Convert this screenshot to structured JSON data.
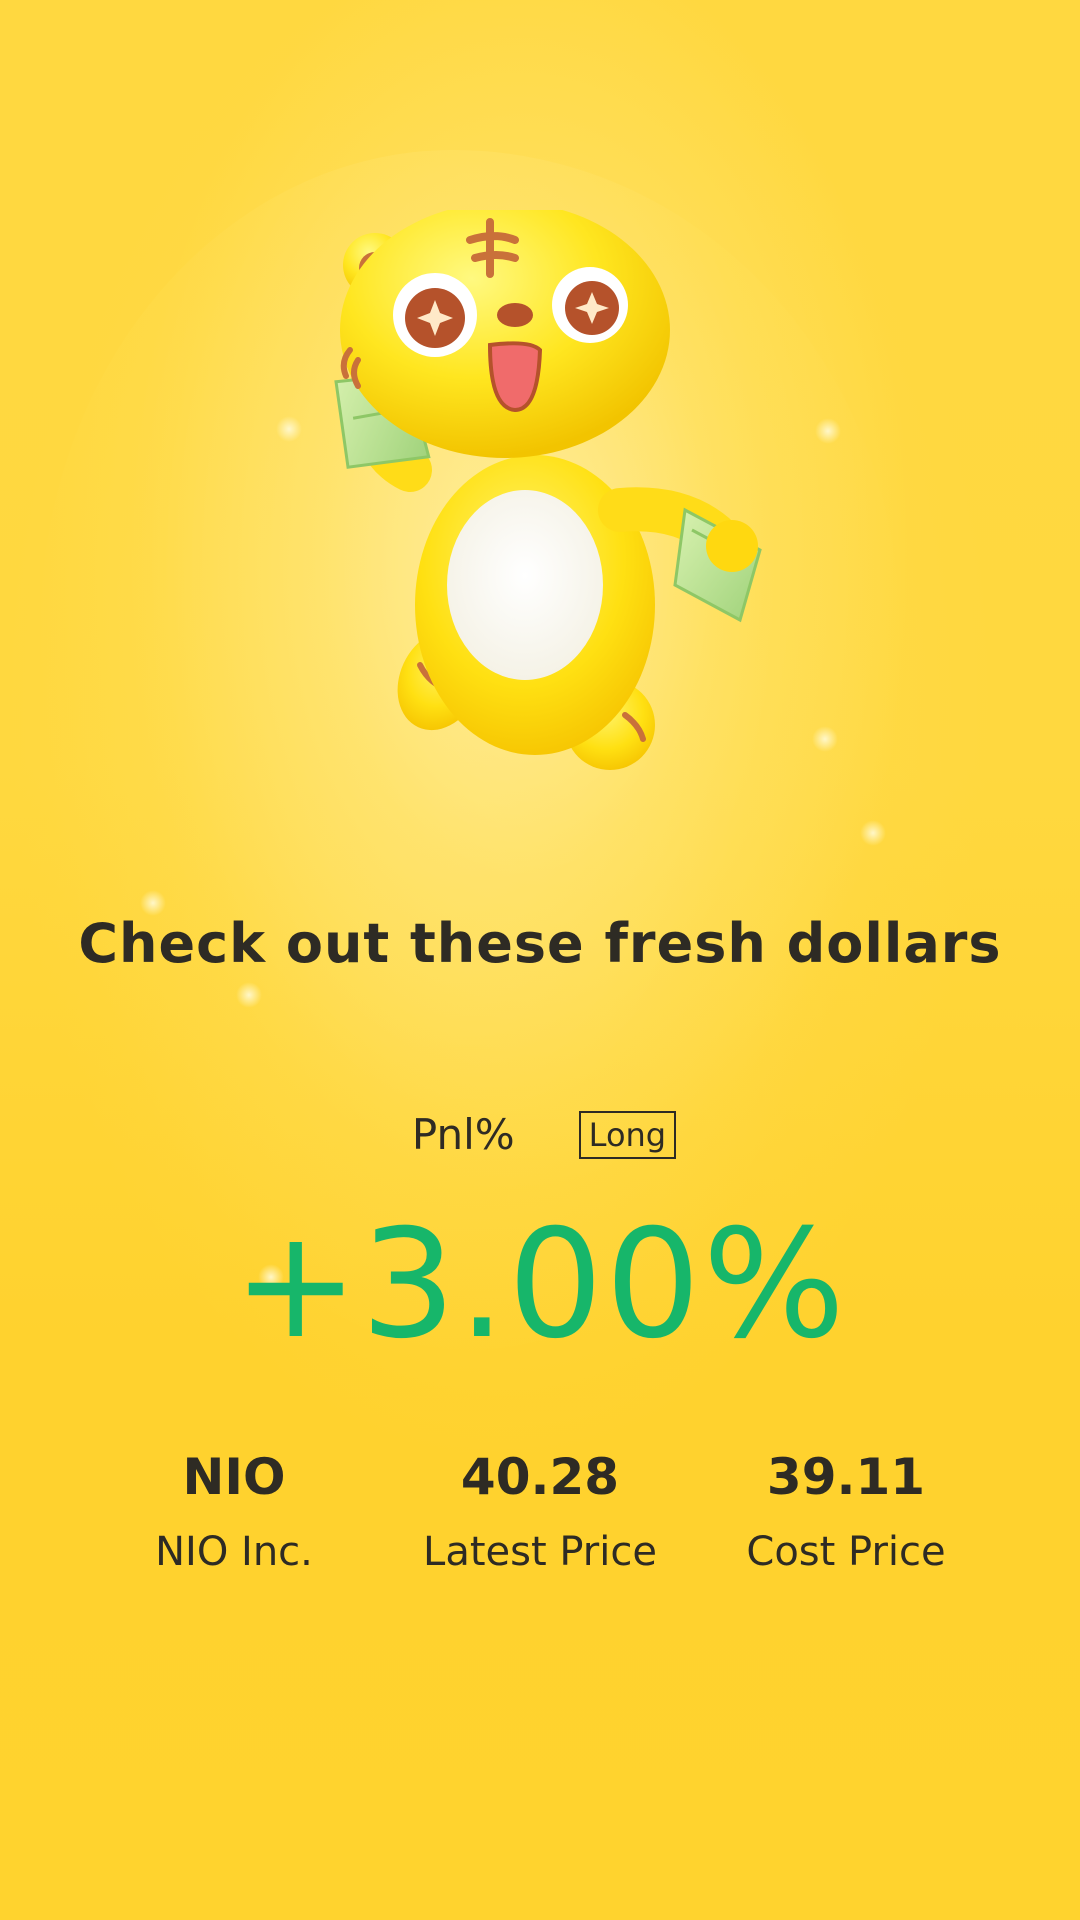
{
  "card": {
    "headline": "Check out these fresh dollars",
    "pnl_label": "Pnl%",
    "position_badge": "Long",
    "pnl_value": "+3.00%",
    "pnl_color": "#17b66a",
    "background_color": "#ffd530"
  },
  "stats": [
    {
      "value": "NIO",
      "label": "NIO Inc."
    },
    {
      "value": "40.28",
      "label": "Latest Price"
    },
    {
      "value": "39.11",
      "label": "Cost Price"
    }
  ],
  "mascot": {
    "icon": "tiger-mascot-holding-cash"
  }
}
